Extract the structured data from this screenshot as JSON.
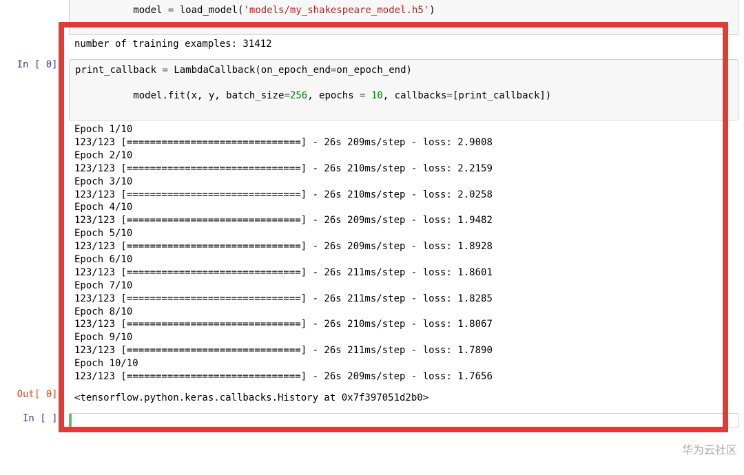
{
  "cell0": {
    "model_assign_prefix": "model = load_model(",
    "model_assign_string": "'models/my_shakespeare_model.h5'",
    "model_assign_suffix": ")",
    "output_line": "number of training examples:  31412"
  },
  "cell1": {
    "prompt": "In [ 0]:",
    "code_line1_lhs": "print_callback",
    "code_line1_eq": " = ",
    "code_line1_fn": "LambdaCallback",
    "code_line1_args_open": "(",
    "code_line1_kw": "on_epoch_end",
    "code_line1_kw_eq": "=",
    "code_line1_val": "on_epoch_end",
    "code_line1_args_close": ")",
    "blank": "",
    "fit_prefix": "model.fit(x, y, ",
    "fit_kw1": "batch_size",
    "fit_kw1_eq": "=",
    "fit_kw1_val": "256",
    "fit_sep1": ", ",
    "fit_kw2": "epochs",
    "fit_kw2_eq": " = ",
    "fit_kw2_val": "10",
    "fit_sep2": ", ",
    "fit_kw3": "callbacks",
    "fit_kw3_eq": "=",
    "fit_kw3_val": "[print_callback]",
    "fit_close": ")"
  },
  "progress_bar": "[==============================]",
  "epochs": [
    {
      "header": "Epoch 1/10",
      "line": "123/123 [==============================] - 26s 209ms/step - loss: 2.9008"
    },
    {
      "header": "Epoch 2/10",
      "line": "123/123 [==============================] - 26s 210ms/step - loss: 2.2159"
    },
    {
      "header": "Epoch 3/10",
      "line": "123/123 [==============================] - 26s 210ms/step - loss: 2.0258"
    },
    {
      "header": "Epoch 4/10",
      "line": "123/123 [==============================] - 26s 209ms/step - loss: 1.9482"
    },
    {
      "header": "Epoch 5/10",
      "line": "123/123 [==============================] - 26s 209ms/step - loss: 1.8928"
    },
    {
      "header": "Epoch 6/10",
      "line": "123/123 [==============================] - 26s 211ms/step - loss: 1.8601"
    },
    {
      "header": "Epoch 7/10",
      "line": "123/123 [==============================] - 26s 211ms/step - loss: 1.8285"
    },
    {
      "header": "Epoch 8/10",
      "line": "123/123 [==============================] - 26s 210ms/step - loss: 1.8067"
    },
    {
      "header": "Epoch 9/10",
      "line": "123/123 [==============================] - 26s 211ms/step - loss: 1.7890"
    },
    {
      "header": "Epoch 10/10",
      "line": "123/123 [==============================] - 26s 209ms/step - loss: 1.7656"
    }
  ],
  "cell1_out": {
    "prompt": "Out[ 0]:",
    "text": "<tensorflow.python.keras.callbacks.History at 0x7f397051d2b0>"
  },
  "cell2": {
    "prompt": "In [ ]:",
    "code": ""
  },
  "watermark": "华为云社区"
}
